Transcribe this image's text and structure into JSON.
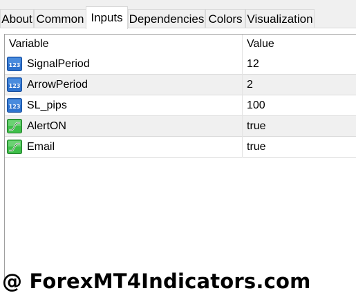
{
  "tabs": [
    {
      "label": "About"
    },
    {
      "label": "Common"
    },
    {
      "label": "Inputs",
      "active": true
    },
    {
      "label": "Dependencies"
    },
    {
      "label": "Colors"
    },
    {
      "label": "Visualization"
    }
  ],
  "grid": {
    "headers": {
      "variable": "Variable",
      "value": "Value"
    },
    "rows": [
      {
        "icon": "int-123-icon",
        "variable": "SignalPeriod",
        "value": "12"
      },
      {
        "icon": "int-123-icon",
        "variable": "ArrowPeriod",
        "value": "2"
      },
      {
        "icon": "int-123-icon",
        "variable": "SL_pips",
        "value": "100"
      },
      {
        "icon": "bool-toggle-icon",
        "variable": "AlertON",
        "value": "true"
      },
      {
        "icon": "bool-toggle-icon",
        "variable": "Email",
        "value": "true"
      }
    ]
  },
  "watermark": "@ ForexMT4Indicators.com",
  "colors": {
    "int_icon": "#1f5fbf",
    "bool_icon": "#2fae3a",
    "row_alt": "#f0f0f0"
  }
}
